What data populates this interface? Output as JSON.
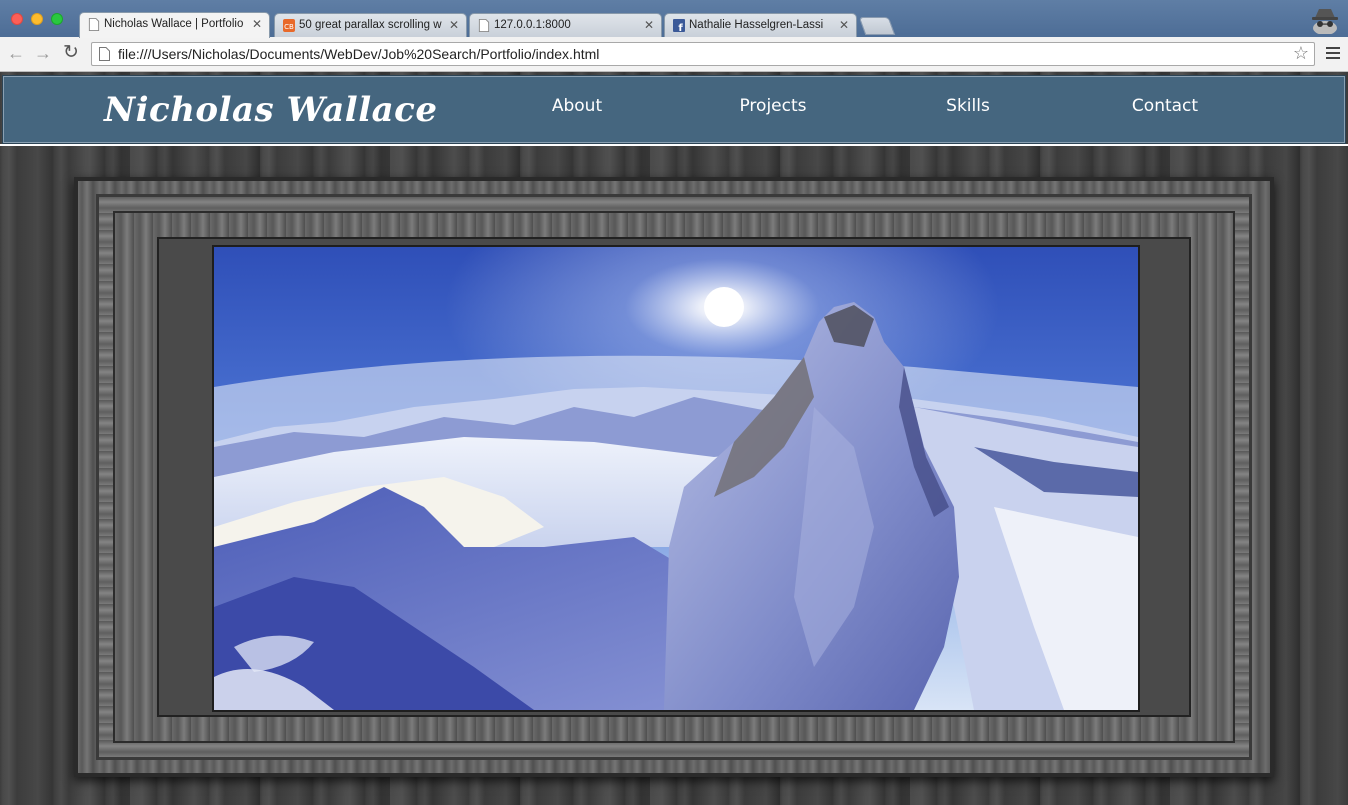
{
  "browser": {
    "tabs": [
      {
        "title": "Nicholas Wallace | Portfolio",
        "icon": "page-icon",
        "active": true
      },
      {
        "title": "50 great parallax scrolling w",
        "icon": "cb-favicon-icon",
        "active": false
      },
      {
        "title": "127.0.0.1:8000",
        "icon": "page-icon",
        "active": false
      },
      {
        "title": "Nathalie Hasselgren-Lassi",
        "icon": "facebook-icon",
        "active": false
      }
    ],
    "url": "file:///Users/Nicholas/Documents/WebDev/Job%20Search/Portfolio/index.html"
  },
  "site": {
    "brand": "Nicholas Wallace",
    "nav": [
      "About",
      "Projects",
      "Skills",
      "Contact"
    ]
  },
  "colors": {
    "nav_bg": "#45667f",
    "chrome_tabbar": "#5a7aa2"
  }
}
